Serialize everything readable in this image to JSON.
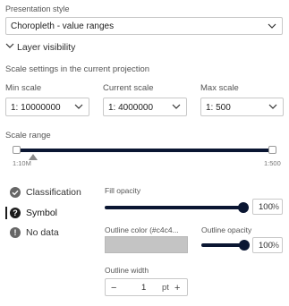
{
  "presentation": {
    "label": "Presentation style",
    "value": "Choropleth - value ranges"
  },
  "layer_visibility": {
    "label": "Layer visibility",
    "scale_settings_title": "Scale settings in the current projection",
    "min_scale": {
      "label": "Min scale",
      "value": "1: 10000000"
    },
    "current_scale": {
      "label": "Current scale",
      "value": "1: 4000000"
    },
    "max_scale": {
      "label": "Max scale",
      "value": "1: 500"
    },
    "scale_range": {
      "label": "Scale range",
      "left_tick": "1:10M",
      "right_tick": "1:500"
    }
  },
  "tabs": [
    {
      "label": "Classification",
      "icon": "check-circle-icon",
      "active": false
    },
    {
      "label": "Symbol",
      "icon": "question-icon",
      "active": true
    },
    {
      "label": "No data",
      "icon": "exclamation-icon",
      "active": false
    }
  ],
  "symbol": {
    "fill_opacity": {
      "label": "Fill opacity",
      "value": "100",
      "unit": "%",
      "level": 1.0
    },
    "outline_color": {
      "label": "Outline color (#c4c4...",
      "color": "#c4c4c4"
    },
    "outline_opacity": {
      "label": "Outline opacity",
      "value": "100",
      "unit": "%",
      "level": 1.0
    },
    "outline_width": {
      "label": "Outline width",
      "value": "1",
      "unit": "pt",
      "minus": "−",
      "plus": "+"
    }
  }
}
